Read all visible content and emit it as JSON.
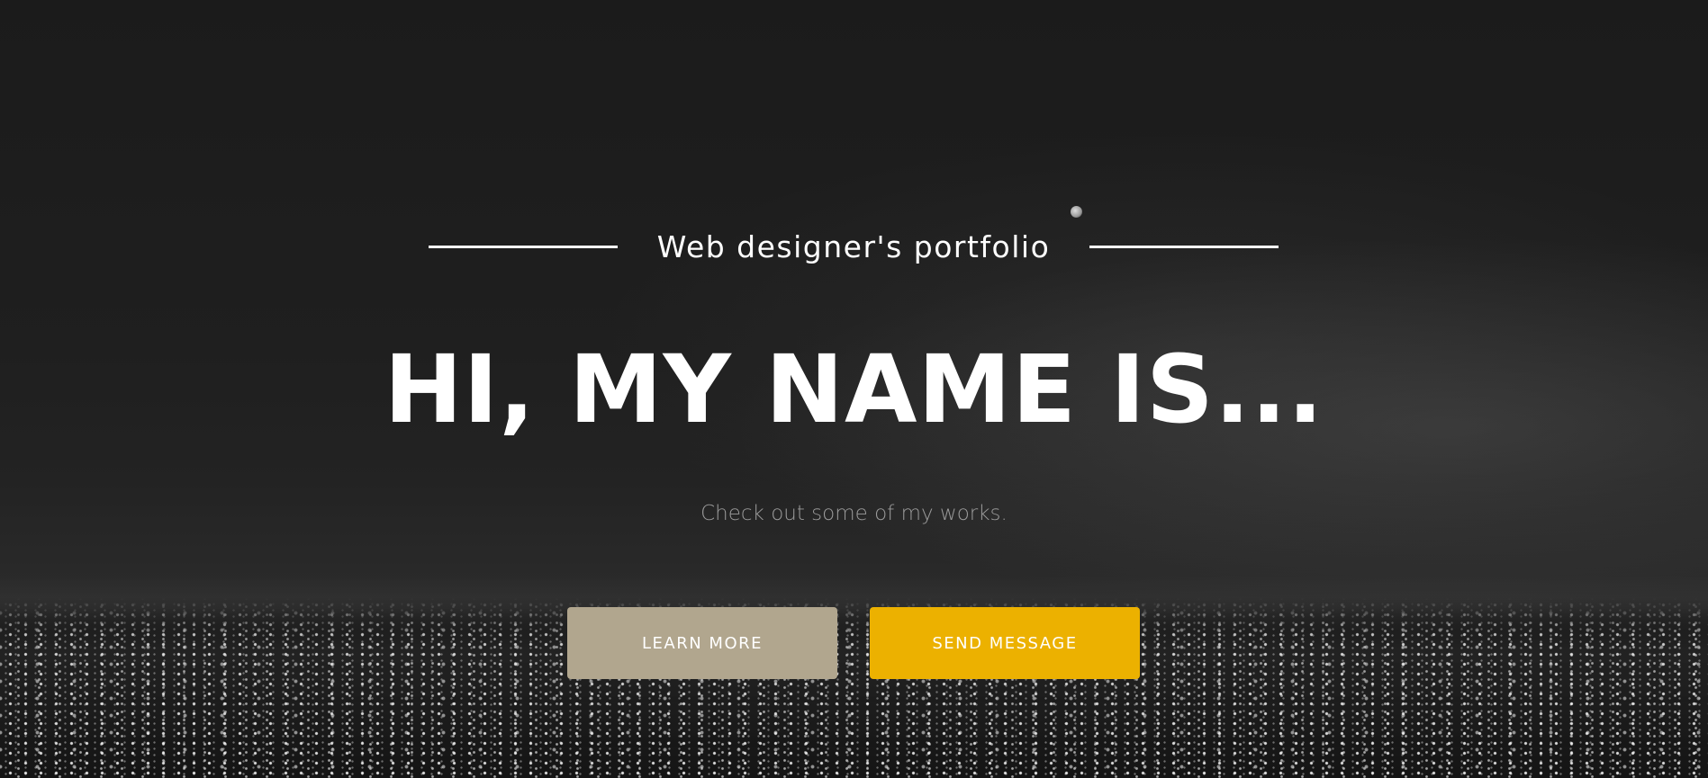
{
  "hero": {
    "tagline": "Web designer's portfolio",
    "headline": "HI, MY NAME IS...",
    "subtitle": "Check out some of my works."
  },
  "actions": {
    "learn_more_label": "LEARN MORE",
    "send_message_label": "SEND MESSAGE"
  },
  "colors": {
    "learn_more_bg": "#b1a68e",
    "send_message_bg": "#ecb100",
    "background": "#1a1a1a",
    "text": "#ffffff",
    "subtitle_text": "#9b9b9b"
  },
  "icons": {
    "background_image": "night-city-skyline-image"
  }
}
